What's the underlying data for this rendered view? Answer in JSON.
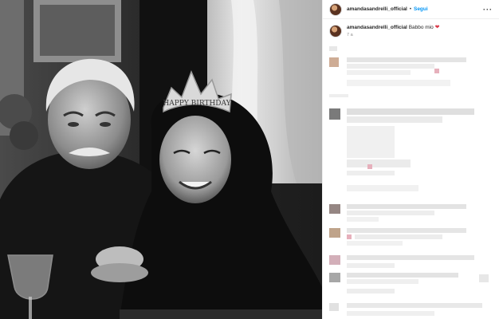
{
  "post": {
    "username": "amandasandrelli_official",
    "follow_label": "Segui",
    "separator": "•",
    "more_label": "···",
    "caption_text": "Babbo mio",
    "caption_emoji": "❤",
    "time_ago": "7 a"
  },
  "photo": {
    "tiara_text": "HAPPY BIRTHDAY"
  },
  "icons": {
    "avatar": "profile-avatar",
    "heart": "red-heart-emoji",
    "more": "more-options-icon"
  },
  "colors": {
    "follow_blue": "#0095f6",
    "heart_red": "#d93b4a"
  }
}
